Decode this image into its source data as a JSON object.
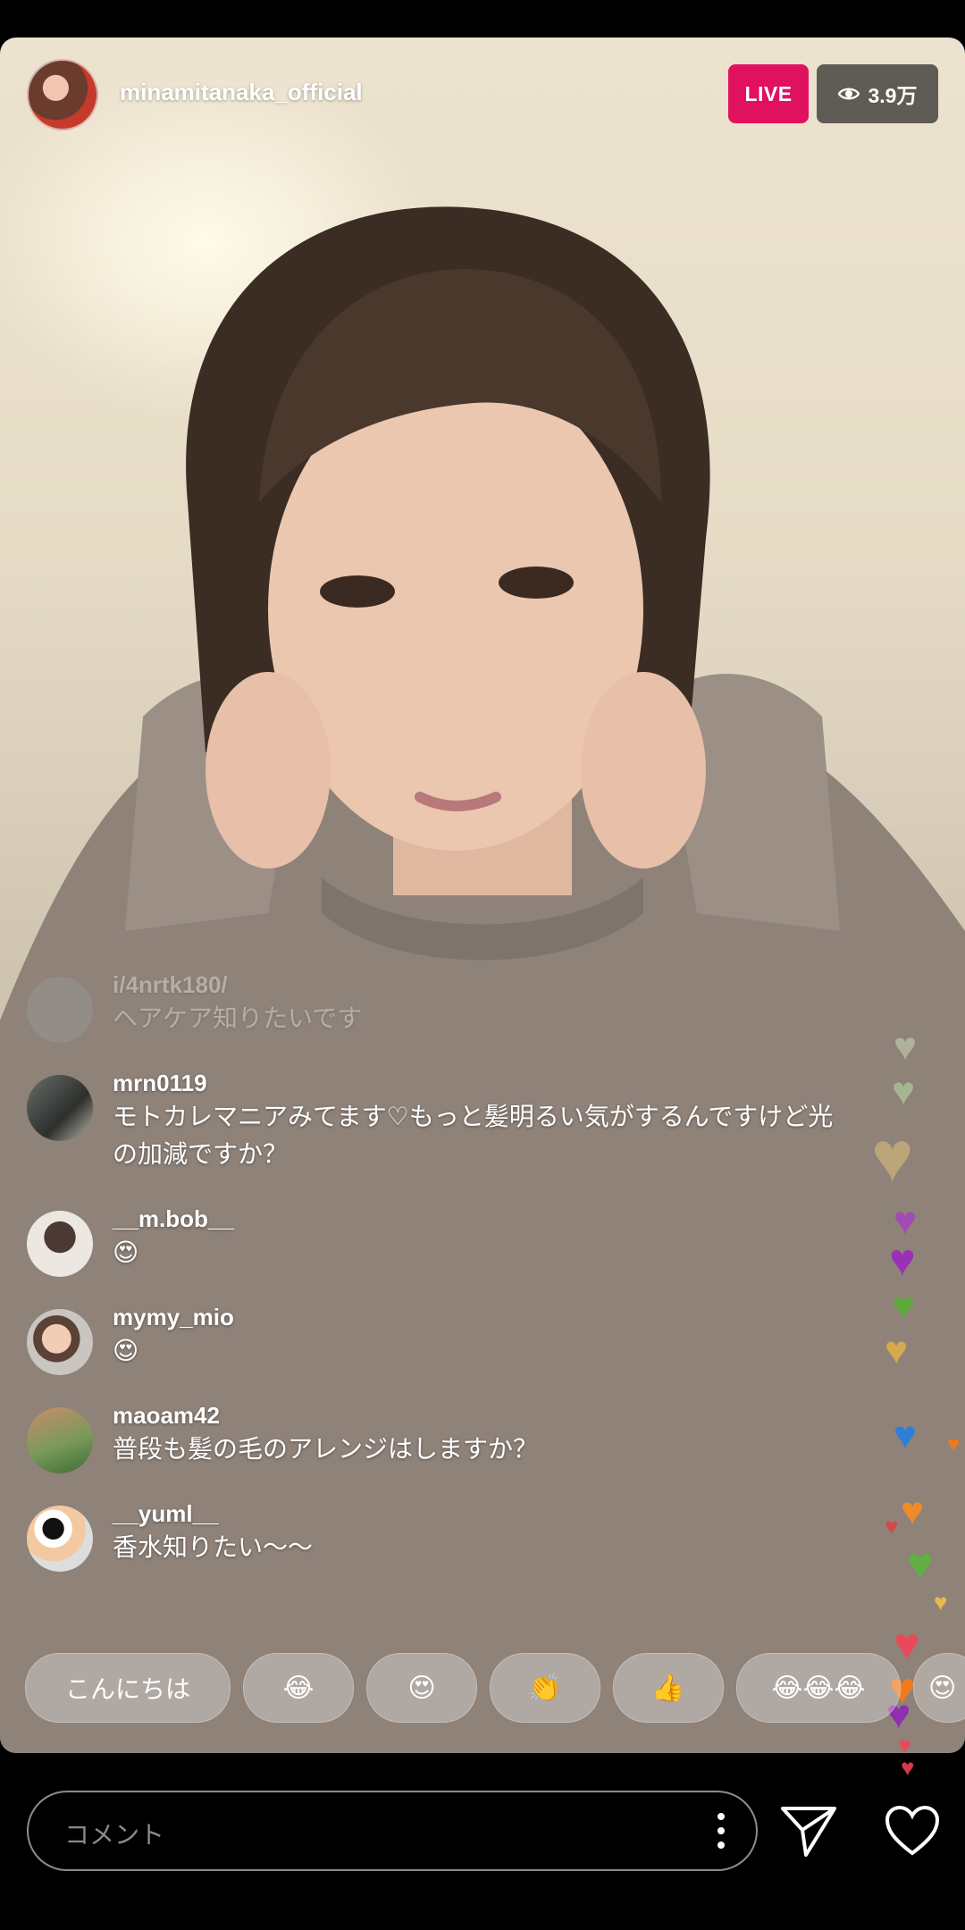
{
  "header": {
    "username": "minamitanaka_official",
    "live_label": "LIVE",
    "viewer_count": "3.9万"
  },
  "comments": [
    {
      "user": "i/4nrtk180/",
      "text": "ヘアケア知りたいです"
    },
    {
      "user": "mrn0119",
      "text": "モトカレマニアみてます♡もっと髪明るい気がするんですけど光の加減ですか？"
    },
    {
      "user": "__m.bob__",
      "text": "😍"
    },
    {
      "user": "mymy_mio",
      "text": "😍"
    },
    {
      "user": "maoam42",
      "text": "普段も髪の毛のアレンジはしますか？"
    },
    {
      "user": "__yuml__",
      "text": "香水知りたい〜〜"
    }
  ],
  "quick_reactions": [
    "こんにちは",
    "😂",
    "😍",
    "👏",
    "👍",
    "😂😂😂",
    "😍"
  ],
  "bottom_bar": {
    "comment_placeholder": "コメント",
    "icons": [
      "more-vertical-icon",
      "send-icon",
      "heart-icon"
    ]
  },
  "colors": {
    "live_badge": "#e0115f",
    "viewer_badge_bg": "#282828"
  }
}
